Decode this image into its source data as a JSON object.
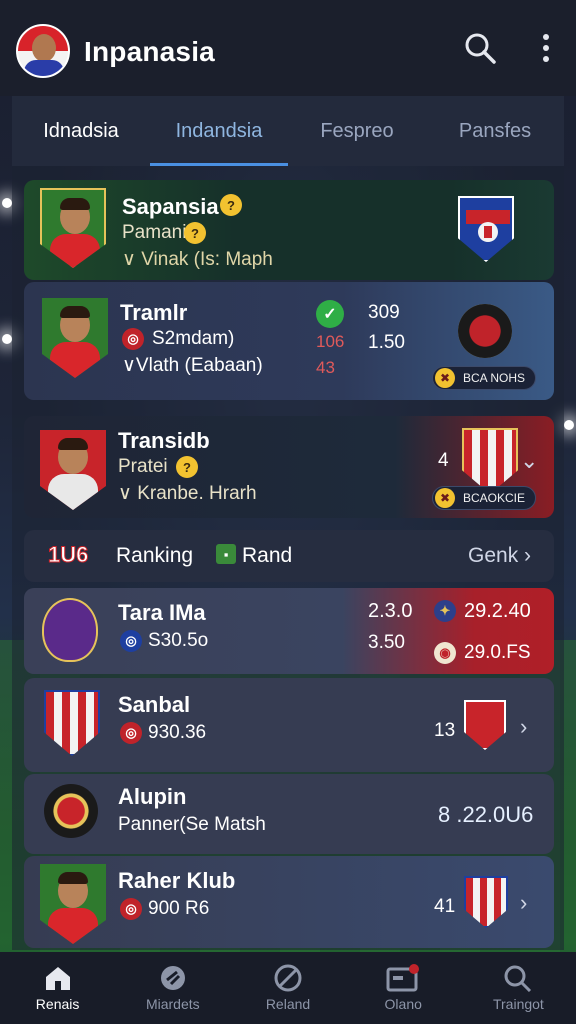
{
  "app": {
    "title": "Inpanasia"
  },
  "tabs": [
    {
      "label": "Idnadsia"
    },
    {
      "label": "Indandsia"
    },
    {
      "label": "Fespreo"
    },
    {
      "label": "Pansfes"
    }
  ],
  "cards": {
    "featured": {
      "name": "Sapansia",
      "role": "Pamani",
      "match": "Vinak (Is: Maph"
    },
    "second": {
      "name": "Tramlr",
      "stat": "S2mdam)",
      "match": "Vlath (Eabaan)",
      "score1": "309",
      "score2": "1.50",
      "red1": "106",
      "red2": "43",
      "pill": "BCA NOHS"
    },
    "third": {
      "name": "Transidb",
      "role": "Pratei",
      "match": "Kranbe. Hrarh",
      "rank": "4",
      "pill": "BCAOKCIE"
    }
  },
  "ranking": {
    "prefix": "1U6",
    "title": "Ranking",
    "rand": "Rand",
    "link": "Genk"
  },
  "rows": [
    {
      "name": "Tara IMa",
      "value": "S30.5o",
      "score1": "2.3.0",
      "score2": "3.50",
      "odds1": "29.2.40",
      "odds2": "29.0.FS"
    },
    {
      "name": "Sanbal",
      "value": "930.36",
      "rank": "13"
    },
    {
      "name": "Alupin",
      "sub": "Panner(Se Matsh",
      "score": "8 .22.0U6"
    },
    {
      "name": "Raher Klub",
      "value": "900 R6",
      "rank": "41"
    }
  ],
  "bottom_nav": [
    {
      "label": "Renais"
    },
    {
      "label": "Miardets"
    },
    {
      "label": "Reland"
    },
    {
      "label": "Olano"
    },
    {
      "label": "Traingot"
    }
  ],
  "icons": {
    "search": "search-icon",
    "menu": "more-vertical-icon",
    "info": "info-icon",
    "chevron": "chevron-right-icon"
  },
  "colors": {
    "accent": "#4a90e2",
    "gold": "#f2c230",
    "red": "#c0232a"
  }
}
